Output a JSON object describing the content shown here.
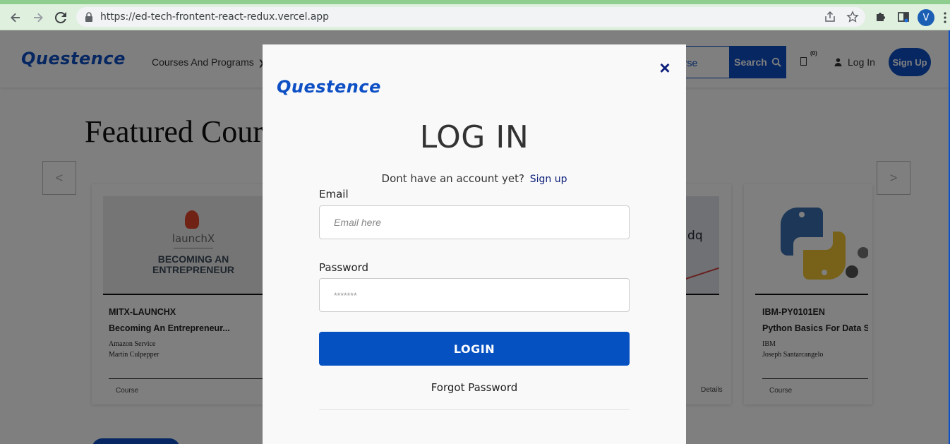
{
  "browser": {
    "url": "https://ed-tech-frontent-react-redux.vercel.app",
    "profile_initial": "V",
    "colors": {
      "frame": "#dff0df",
      "accent": "#8fce8f"
    }
  },
  "header": {
    "logo": "Questence",
    "nav_courses": "Courses And Programs",
    "search_placeholder": "urse",
    "search_button": "Search",
    "cart_count": "(0)",
    "login": "Log In",
    "signup": "Sign Up"
  },
  "featured": {
    "title": "Featured Cours",
    "prev_arrow": "<",
    "next_arrow": ">",
    "cards": [
      {
        "image_banner_logo": "launchX",
        "image_banner_title": "BECOMING AN ENTREPRENEUR",
        "code": "MITX-LAUNCHX",
        "name": "Becoming An Entrepreneur...",
        "org": "Amazon Service",
        "instructor": "Martin Culpepper",
        "type": "Course"
      },
      {
        "image_math": ") dq",
        "type": "Details"
      },
      {
        "code": "IBM-PY0101EN",
        "name": "Python Basics For Data S",
        "org": "IBM",
        "instructor": "Joseph Santarcangelo",
        "type": "Course"
      }
    ]
  },
  "modal": {
    "logo": "Questence",
    "close_icon": "×",
    "title": "LOG IN",
    "signup_prompt": "Dont have an account yet?",
    "signup_link": "Sign up",
    "email_label": "Email",
    "email_placeholder": "Email here",
    "password_label": "Password",
    "password_placeholder": "*******",
    "login_button": "LOGIN",
    "forgot_password": "Forgot Password"
  },
  "colors": {
    "brand_blue": "#0d4fc4",
    "login_button": "#0651c2",
    "close_icon": "#0b1e7a"
  }
}
